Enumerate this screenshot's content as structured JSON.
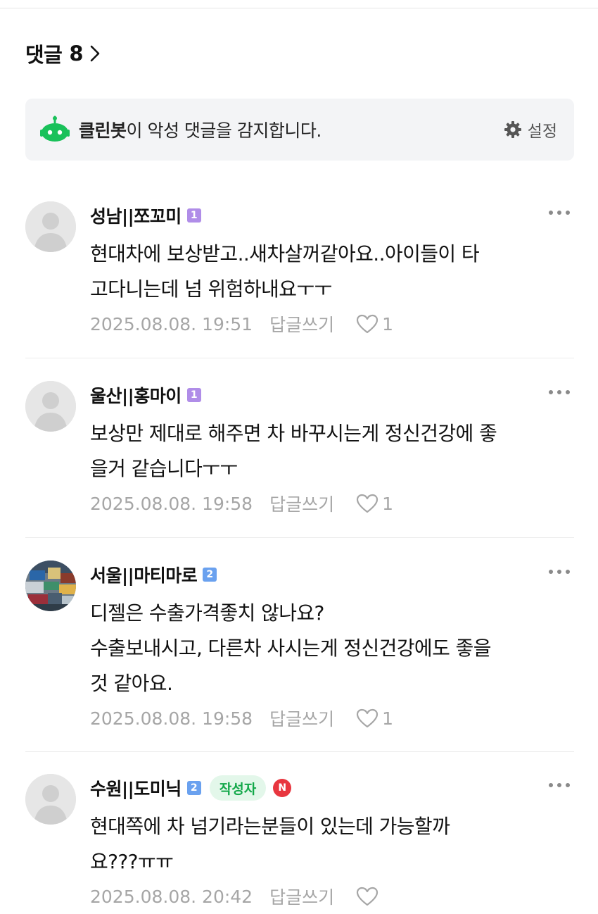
{
  "header": {
    "title": "댓글",
    "count": "8"
  },
  "cleanbot": {
    "name": "클린봇",
    "message": "이 악성 댓글을 감지합니다.",
    "settings_label": "설정"
  },
  "comments": [
    {
      "author": "성남||쪼꼬미",
      "level": "1",
      "text": "현대차에 보상받고..새차살꺼같아요..아이들이 타\n고다니는데 넘 위험하내요ㅜㅜ",
      "date": "2025.08.08. 19:51",
      "reply": "답글쓰기",
      "likes": "1"
    },
    {
      "author": "울산||홍마이",
      "level": "1",
      "text": "보상만 제대로 해주면 차 바꾸시는게 정신건강에 좋\n을거 같습니다ㅜㅜ",
      "date": "2025.08.08. 19:58",
      "reply": "답글쓰기",
      "likes": "1"
    },
    {
      "author": "서울||마티마로",
      "level": "2",
      "text": "디젤은 수출가격좋치 않나요?\n수출보내시고, 다른차 사시는게 정신건강에도 좋을\n것 같아요.",
      "date": "2025.08.08. 19:58",
      "reply": "답글쓰기",
      "likes": "1"
    },
    {
      "author": "수원||도미닉",
      "level": "2",
      "writer_badge": "작성자",
      "n_badge": "N",
      "text": "현대쪽에 차 넘기라는분들이 있는데 가능할까\n요???ㅠㅠ",
      "date": "2025.08.08. 20:42",
      "reply": "답글쓰기",
      "likes": ""
    }
  ],
  "colors": {
    "accent_green": "#13a84a",
    "bot_green": "#19c15a",
    "level1": "#b08de8",
    "level2": "#6aa1ef",
    "new_red": "#e8363f"
  }
}
